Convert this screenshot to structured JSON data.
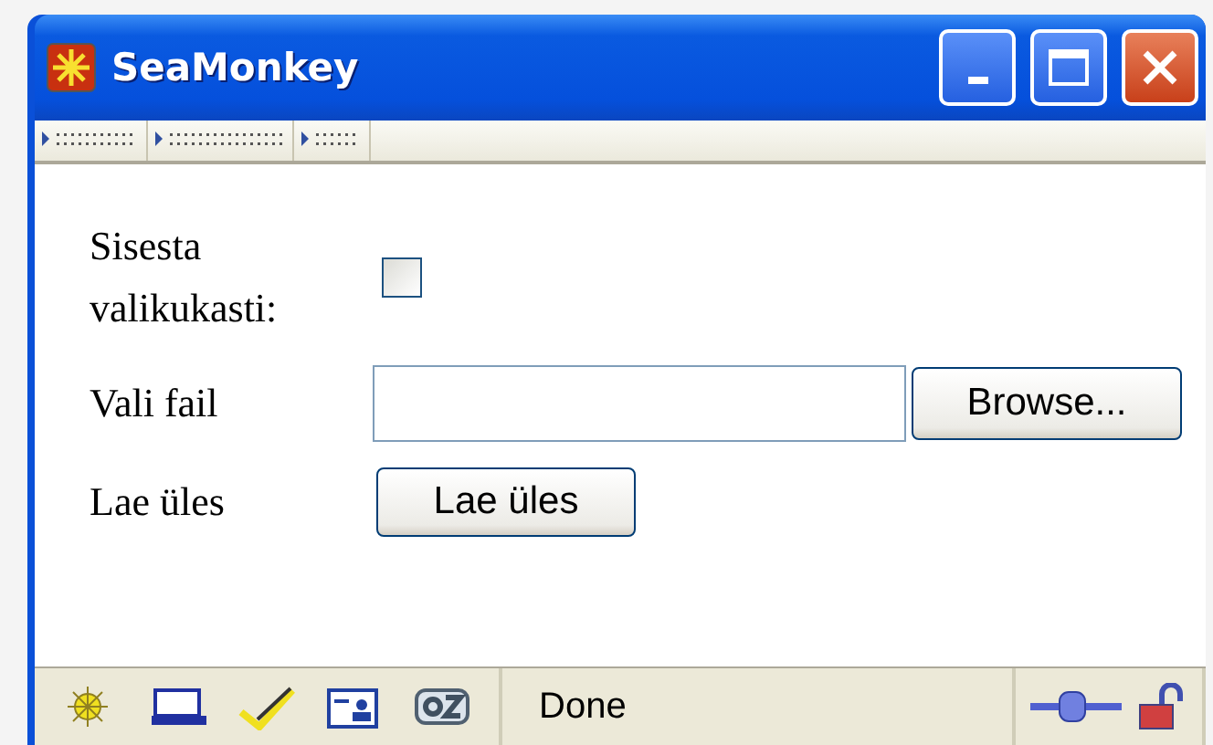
{
  "window": {
    "title": "SeaMonkey"
  },
  "form": {
    "checkbox_row": {
      "label": "Sisesta valikukasti:",
      "checked": false
    },
    "file_row": {
      "label": "Vali fail",
      "button": "Browse..."
    },
    "upload_row": {
      "label": "Lae üles",
      "button": "Lae üles"
    }
  },
  "status_bar": {
    "text": "Done"
  }
}
